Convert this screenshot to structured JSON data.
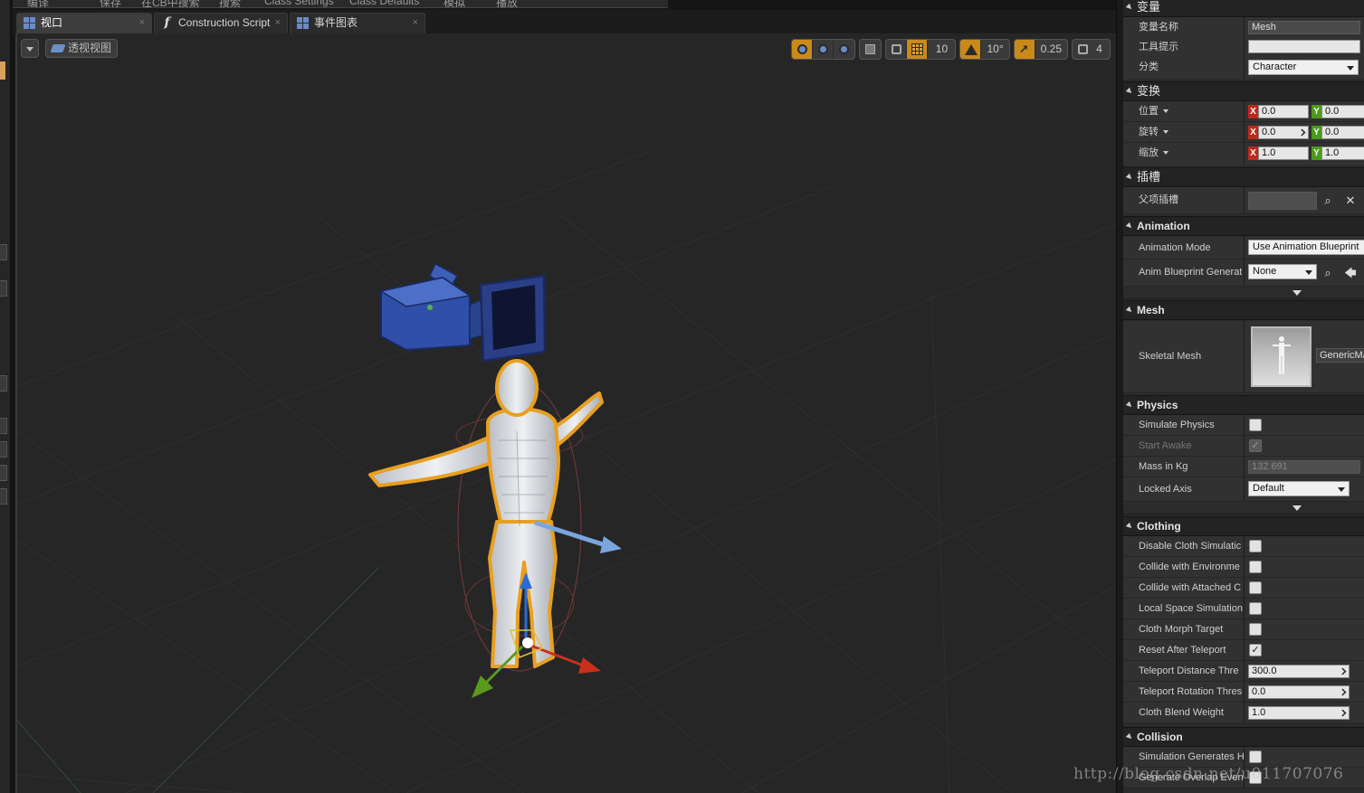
{
  "top_menu": [
    "编译",
    "保存",
    "在CB中搜索",
    "搜索",
    "Class Settings",
    "Class Defaults",
    "模拟",
    "播放"
  ],
  "tabs": [
    {
      "label": "视口",
      "close": "×",
      "icon": "grid-icon"
    },
    {
      "label": "Construction Script",
      "close": "×",
      "icon": "function-icon"
    },
    {
      "label": "事件图表",
      "close": "×",
      "icon": "graph-icon"
    }
  ],
  "viewport": {
    "view_mode": "透视视图",
    "toolbar": {
      "grid_snap": "10",
      "rotation_snap": "10°",
      "scale_snap": "0.25",
      "camera_speed": "4"
    }
  },
  "details": {
    "variable": {
      "header": "变量",
      "name_label": "变量名称",
      "name_value": "Mesh",
      "tooltip_label": "工具提示",
      "tooltip_value": "",
      "category_label": "分类",
      "category_value": "Character"
    },
    "transform": {
      "header": "变换",
      "location_label": "位置",
      "rotation_label": "旋转",
      "scale_label": "缩放",
      "axis_x": "X",
      "axis_y": "Y",
      "location": {
        "x": "0.0",
        "y": "0.0"
      },
      "rotation": {
        "x": "0.0",
        "y": "0.0"
      },
      "scale": {
        "x": "1.0",
        "y": "1.0"
      }
    },
    "sockets": {
      "header": "插槽",
      "parent_socket_label": "父项插槽",
      "parent_socket_value": "",
      "search": "⌕",
      "clear": "✕"
    },
    "animation": {
      "header": "Animation",
      "mode_label": "Animation Mode",
      "mode_value": "Use Animation Blueprint",
      "blueprint_label": "Anim Blueprint Generat",
      "blueprint_value": "None",
      "search": "⌕",
      "use": "🡄"
    },
    "mesh": {
      "header": "Mesh",
      "skeletal_mesh_label": "Skeletal Mesh",
      "skeletal_mesh_value": "GenericMale"
    },
    "physics": {
      "header": "Physics",
      "simulate_label": "Simulate Physics",
      "simulate_checked": false,
      "start_awake_label": "Start Awake",
      "start_awake_checked": true,
      "mass_label": "Mass in Kg",
      "mass_value": "132.691",
      "locked_axis_label": "Locked Axis",
      "locked_axis_value": "Default"
    },
    "clothing": {
      "header": "Clothing",
      "rows": [
        {
          "label": "Disable Cloth Simulatic",
          "type": "check",
          "checked": false
        },
        {
          "label": "Collide with Environme",
          "type": "check",
          "checked": false
        },
        {
          "label": "Collide with Attached C",
          "type": "check",
          "checked": false
        },
        {
          "label": "Local Space Simulation",
          "type": "check",
          "checked": false
        },
        {
          "label": "Cloth Morph Target",
          "type": "check",
          "checked": false
        },
        {
          "label": "Reset After Teleport",
          "type": "check",
          "checked": true
        },
        {
          "label": "Teleport Distance Thre",
          "type": "number",
          "value": "300.0"
        },
        {
          "label": "Teleport Rotation Thres",
          "type": "number",
          "value": "0.0"
        },
        {
          "label": "Cloth Blend Weight",
          "type": "number",
          "value": "1.0"
        }
      ]
    },
    "collision": {
      "header": "Collision",
      "rows": [
        {
          "label": "Simulation Generates H",
          "checked": false
        },
        {
          "label": "Generate Overlap Even",
          "checked": false
        }
      ]
    }
  },
  "watermark": "http://blog.csdn.net/u011707076",
  "colors": {
    "viewport_bg": "#262626",
    "selection_outline": "#e8a020",
    "camera_blue": "#2f4fa8",
    "gizmo_x": "#c8301c",
    "gizmo_y": "#5a9a1c",
    "gizmo_z": "#2a6ad8",
    "forward_arrow": "#7aa6e0"
  }
}
